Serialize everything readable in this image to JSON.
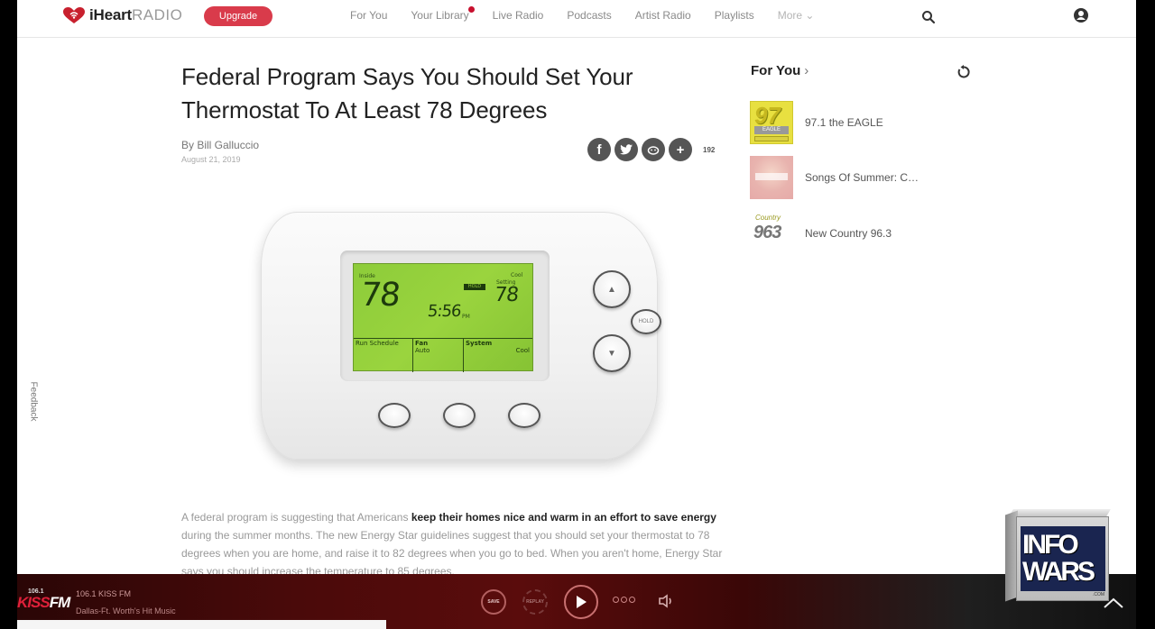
{
  "header": {
    "logo_bold": "iHeart",
    "logo_light": "RADIO",
    "upgrade_label": "Upgrade",
    "nav": [
      {
        "label": "For You"
      },
      {
        "label": "Your Library",
        "has_badge": true
      },
      {
        "label": "Live Radio"
      },
      {
        "label": "Podcasts"
      },
      {
        "label": "Artist Radio"
      },
      {
        "label": "Playlists"
      },
      {
        "label": "More ⌄"
      }
    ],
    "icons": {
      "search": "search-icon",
      "account": "user-icon"
    },
    "brand_color": "#d93b4b"
  },
  "article": {
    "title": "Federal Program Says You Should Set Your Thermostat To At Least 78 Degrees",
    "byline": "By Bill Galluccio",
    "date": "August 21, 2019",
    "share": {
      "buttons": [
        "facebook-icon",
        "twitter-icon",
        "reddit-icon",
        "more-share-icon"
      ],
      "count": "192"
    },
    "image": {
      "alt": "Programmable thermostat",
      "inside_label": "Inside",
      "inside_temp": "78",
      "hold_tag": "HOLD",
      "time": "5:56",
      "time_suffix": "PM",
      "cool_label": "Cool",
      "setting_label": "Setting",
      "setting_temp": "78",
      "cells": [
        {
          "title": "Run Schedule",
          "value": ""
        },
        {
          "title": "Fan",
          "value": "Auto"
        },
        {
          "title": "System",
          "value": "Cool"
        }
      ],
      "hold_button": "HOLD"
    },
    "body_intro": "A federal program is suggesting that Americans ",
    "body_bold": "keep their homes nice and warm in an effort to save energy",
    "body_rest": " during the summer months. The new Energy Star guidelines suggest that you should set your thermostat to 78 degrees when you are home, and raise it to 82 degrees when you go to bed. When you aren't home, Energy Star says you should increase the temperature to 85 degrees."
  },
  "sidebar": {
    "title": "For You",
    "chevron": "›",
    "items": [
      {
        "label": "97.1 the EAGLE",
        "thumb_text": "97",
        "thumb_bar": "EAGLE"
      },
      {
        "label": "Songs Of Summer: C…"
      },
      {
        "label": "New Country 96.3",
        "thumb_top": "Country",
        "thumb_text": "963"
      }
    ]
  },
  "feedback_label": "Feedback",
  "player": {
    "station_num": "106.1",
    "station_logo_a": "KISS",
    "station_logo_b": "FM",
    "station_name": "106.1 KISS FM",
    "station_desc": "Dallas-Ft. Worth's Hit Music",
    "save_label": "SAVE",
    "replay_label": "REPLAY",
    "controls": [
      "save-button",
      "replay-button",
      "play-button",
      "more-options-button",
      "volume-button"
    ]
  },
  "overlay": {
    "line1": "INFO",
    "line2": "WARS",
    "sub": ".COM"
  }
}
